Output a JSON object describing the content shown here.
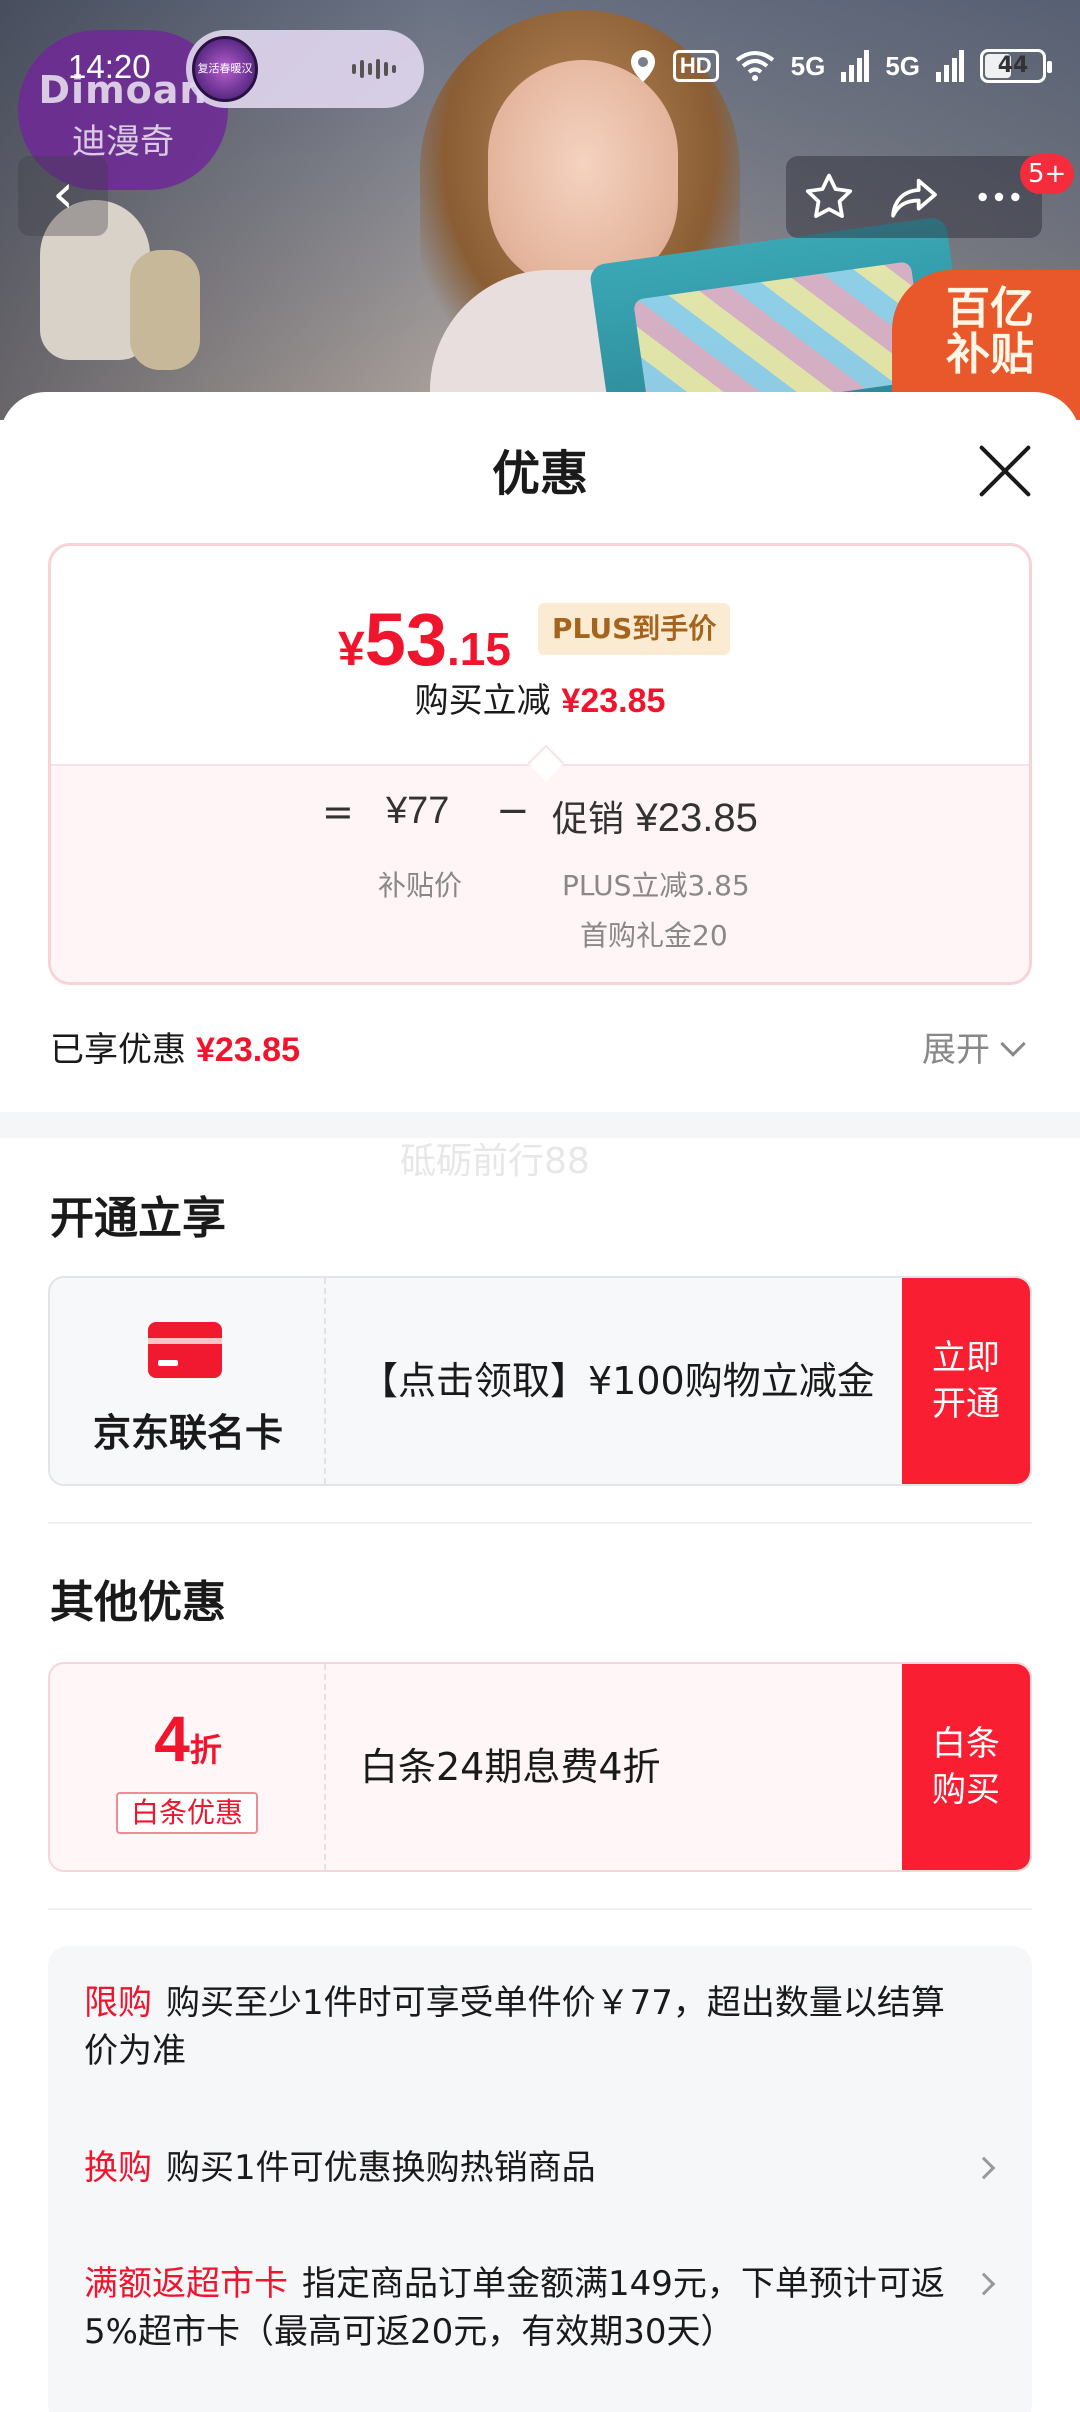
{
  "hero": {
    "brand_en": "Dimoan",
    "brand_cn": "迪漫奇",
    "subsidy_line1": "百亿",
    "subsidy_line2": "补贴"
  },
  "status_bar": {
    "time": "14:20",
    "island_label": "复活春暖汉",
    "hd_label": "HD",
    "net1": "5G",
    "net2": "5G",
    "battery": "44",
    "battery_level": 0.44
  },
  "nav": {
    "back_icon": "chevron-left-icon",
    "favorite_icon": "star-icon",
    "share_icon": "share-icon",
    "more_icon": "more-dots-icon",
    "badge": "5+"
  },
  "sheet": {
    "title": "优惠",
    "close_icon": "close-icon"
  },
  "price": {
    "currency": "¥",
    "integer": "53",
    "decimal": ".15",
    "plus_tag": "PLUS到手价",
    "instant_label": "购买立减",
    "instant_value": "¥23.85",
    "eq": "=",
    "subsidy_price": "¥77",
    "minus": "−",
    "promo_label": "促销",
    "promo_value": "¥23.85",
    "subsidy_price_label": "补贴价",
    "plus_reduce": "PLUS立减3.85",
    "first_buy_gift": "首购礼金20"
  },
  "enjoyed": {
    "label": "已享优惠",
    "value": "¥23.85",
    "expand": "展开"
  },
  "watermark": "砥砺前行88",
  "open_section": {
    "title": "开通立享",
    "card_name": "京东联名卡",
    "desc": "【点击领取】¥100购物立减金",
    "cta": "立即开通"
  },
  "other_section": {
    "title": "其他优惠",
    "discount_num": "4",
    "discount_unit": "折",
    "discount_tag": "白条优惠",
    "desc": "白条24期息费4折",
    "cta": "白条购买"
  },
  "rules": [
    {
      "tag": "限购",
      "text": "购买至少1件时可享受单件价￥77，超出数量以结算价为准"
    },
    {
      "tag": "换购",
      "text": "购买1件可优惠换购热销商品"
    },
    {
      "tag": "满额返超市卡",
      "text": "指定商品订单金额满149元，下单预计可返5%超市卡（最高可返20元，有效期30天）"
    }
  ],
  "colors": {
    "accent_red": "#f0142d",
    "cta_red": "#fa1e32",
    "plus_gold": "#a4641e"
  }
}
